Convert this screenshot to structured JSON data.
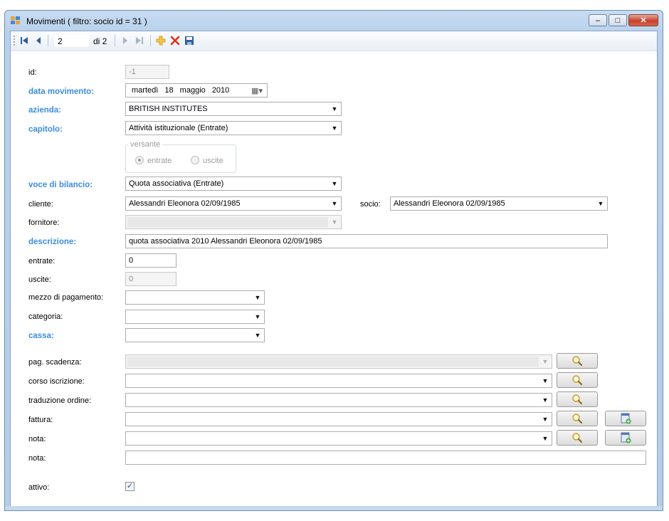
{
  "window": {
    "title": "Movimenti ( filtro: socio id = 31 )",
    "controls": {
      "minimize": "–",
      "maximize": "□",
      "close": "✕"
    }
  },
  "navigator": {
    "position": "2",
    "count": "di 2",
    "icons": {
      "first": "⏮",
      "prev": "◀",
      "next": "▶",
      "last": "⏭",
      "add": "✚",
      "delete": "✖",
      "save": "💾"
    }
  },
  "form": {
    "id": {
      "label": "id:",
      "value": "-1"
    },
    "data_movimento": {
      "label": "data movimento:",
      "day": "martedì",
      "date": "18",
      "month": "maggio",
      "year": "2010"
    },
    "azienda": {
      "label": "azienda:",
      "value": "BRITISH INSTITUTES"
    },
    "capitolo": {
      "label": "capitolo:",
      "value": "Attività istituzionale (Entrate)"
    },
    "versante": {
      "title": "versante",
      "entrate": "entrate",
      "uscite": "uscite"
    },
    "voce_di_bilancio": {
      "label": "voce di bilancio:",
      "value": "Quota associativa (Entrate)"
    },
    "cliente": {
      "label": "cliente:",
      "value": "Alessandri Eleonora 02/09/1985"
    },
    "socio": {
      "label": "socio:",
      "value": "Alessandri Eleonora 02/09/1985"
    },
    "fornitore": {
      "label": "fornitore:",
      "value": ""
    },
    "descrizione": {
      "label": "descrizione:",
      "value": "quota associativa 2010 Alessandri Eleonora 02/09/1985"
    },
    "entrate": {
      "label": "entrate:",
      "value": "0"
    },
    "uscite": {
      "label": "uscite:",
      "value": "0"
    },
    "mezzo_di_pagamento": {
      "label": "mezzo di pagamento:",
      "value": ""
    },
    "categoria": {
      "label": "categoria:",
      "value": ""
    },
    "cassa": {
      "label": "cassa:",
      "value": ""
    },
    "pag_scadenza": {
      "label": "pag. scadenza:",
      "value": ""
    },
    "corso_iscrizione": {
      "label": "corso iscrizione:",
      "value": ""
    },
    "traduzione_ordine": {
      "label": "traduzione ordine:",
      "value": ""
    },
    "fattura": {
      "label": "fattura:",
      "value": ""
    },
    "nota_combo": {
      "label": "nota:",
      "value": ""
    },
    "nota_text": {
      "label": "nota:",
      "value": ""
    },
    "attivo": {
      "label": "attivo:",
      "checked": "✓"
    }
  },
  "colors": {
    "bold_label": "#3c8ede",
    "window_frame": "#b9d1ec"
  }
}
